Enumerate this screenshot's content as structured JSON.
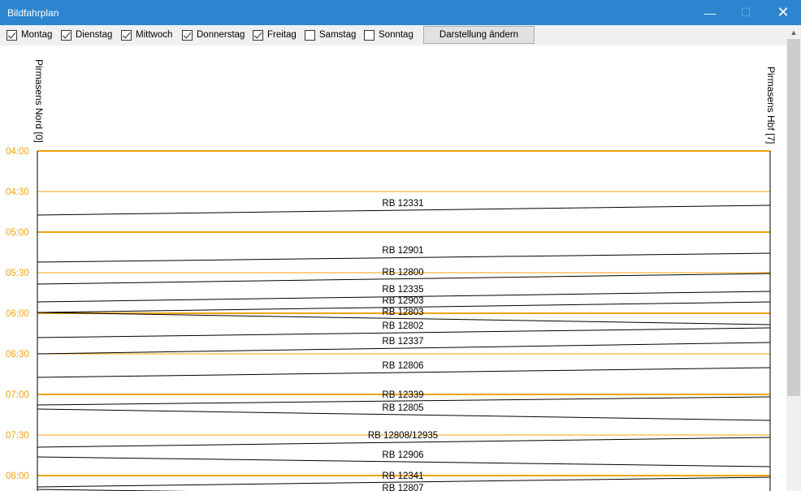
{
  "window": {
    "title": "Bildfahrplan"
  },
  "toolbar": {
    "days": [
      {
        "label": "Montag",
        "checked": true
      },
      {
        "label": "Dienstag",
        "checked": true
      },
      {
        "label": "Mittwoch",
        "checked": true
      },
      {
        "label": "Donnerstag",
        "checked": true
      },
      {
        "label": "Freitag",
        "checked": true
      },
      {
        "label": "Samstag",
        "checked": false
      },
      {
        "label": "Sonntag",
        "checked": false
      }
    ],
    "change_label": "Darstellung ändern"
  },
  "stations": {
    "left": "Pirmasens Nord [0]",
    "right": "Pirmasens Hbf [7]"
  },
  "colors": {
    "time_line": "#f0a30a",
    "train_line": "#000000",
    "time_label": "#f0a30a"
  },
  "times": [
    "04:00",
    "04:30",
    "05:00",
    "05:30",
    "06:00",
    "06:30",
    "07:00",
    "07:30",
    "08:00"
  ],
  "trains": [
    "RB 12331",
    "RB 12901",
    "RB 12800",
    "RB 12335",
    "RB 12903",
    "RB 12803",
    "RB 12802",
    "RB 12337",
    "RB 12806",
    "RB 12339",
    "RB 12805",
    "RB 12808/12935",
    "RB 12906",
    "RB 12341",
    "RB 12807"
  ]
}
